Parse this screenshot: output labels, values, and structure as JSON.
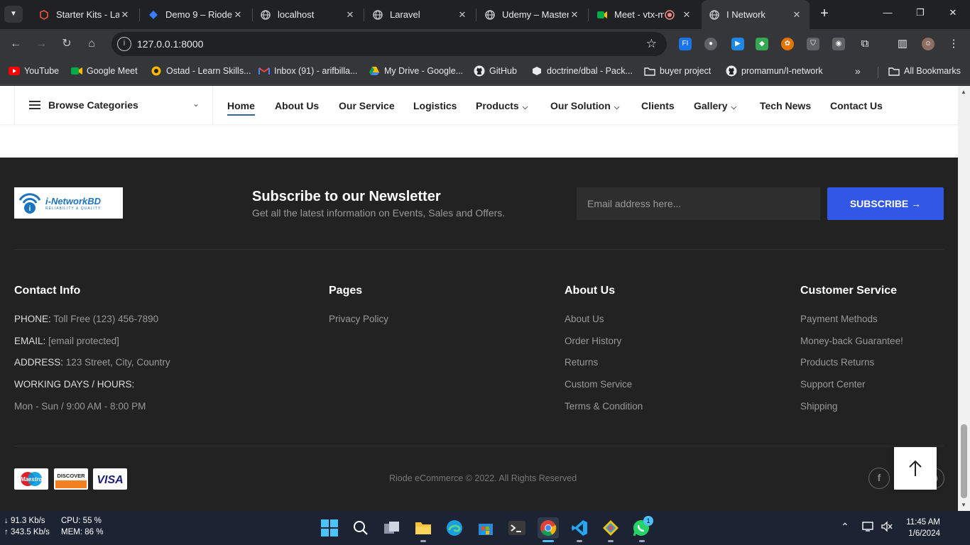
{
  "browser": {
    "tabs": [
      {
        "title": "Starter Kits - Lara",
        "icon": "laravel-icon",
        "color": "#f05340"
      },
      {
        "title": "Demo 9 – Riode",
        "icon": "riode-icon",
        "color": "#3a7cff"
      },
      {
        "title": "localhost",
        "icon": "globe-icon",
        "color": "#c4c7c5"
      },
      {
        "title": "Laravel",
        "icon": "globe-icon",
        "color": "#c4c7c5"
      },
      {
        "title": "Udemy – Master",
        "icon": "globe-icon",
        "color": "#c4c7c5"
      },
      {
        "title": "Meet - vtx-m",
        "icon": "meet-icon",
        "color": "#00ac47"
      },
      {
        "title": "I Network",
        "icon": "globe-icon",
        "color": "#c4c7c5",
        "active": true
      }
    ],
    "url": "127.0.0.1:8000",
    "bookmarks": [
      {
        "label": "YouTube",
        "icon": "youtube-icon"
      },
      {
        "label": "Google Meet",
        "icon": "meet-icon"
      },
      {
        "label": "Ostad - Learn Skills...",
        "icon": "ostad-icon"
      },
      {
        "label": "Inbox (91) - arifbilla...",
        "icon": "gmail-icon"
      },
      {
        "label": "My Drive - Google...",
        "icon": "drive-icon"
      },
      {
        "label": "GitHub",
        "icon": "github-icon"
      },
      {
        "label": "doctrine/dbal - Pack...",
        "icon": "packagist-icon"
      },
      {
        "label": "buyer project",
        "icon": "folder-icon"
      },
      {
        "label": "promamun/I-network",
        "icon": "github-icon"
      }
    ],
    "all_bookmarks": "All Bookmarks"
  },
  "navbar": {
    "browse_label": "Browse Categories",
    "menu": [
      {
        "label": "Home",
        "active": true
      },
      {
        "label": "About Us"
      },
      {
        "label": "Our Service"
      },
      {
        "label": "Logistics"
      },
      {
        "label": "Products",
        "dropdown": true
      },
      {
        "label": "Our Solution",
        "dropdown": true
      },
      {
        "label": "Clients"
      },
      {
        "label": "Gallery",
        "dropdown": true
      },
      {
        "label": "Tech News"
      },
      {
        "label": "Contact Us"
      }
    ]
  },
  "footer": {
    "logo_line1": "i-NetworkBD",
    "logo_line2": "RELIABILITY & QUALITY",
    "newsletter_title": "Subscribe to our Newsletter",
    "newsletter_sub": "Get all the latest information on Events, Sales and Offers.",
    "email_placeholder": "Email address here...",
    "subscribe_label": "SUBSCRIBE →",
    "contact": {
      "title": "Contact Info",
      "phone_label": "PHONE:",
      "phone": "Toll Free (123) 456-7890",
      "email_label": "EMAIL:",
      "email": "[email protected]",
      "address_label": "ADDRESS:",
      "address": "123 Street, City, Country",
      "hours_label": "WORKING DAYS / HOURS:",
      "hours": "Mon - Sun / 9:00 AM - 8:00 PM"
    },
    "pages": {
      "title": "Pages",
      "links": [
        "Privacy Policy"
      ]
    },
    "about": {
      "title": "About Us",
      "links": [
        "About Us",
        "Order History",
        "Returns",
        "Custom Service",
        "Terms & Condition"
      ]
    },
    "customer": {
      "title": "Customer Service",
      "links": [
        "Payment Methods",
        "Money-back Guarantee!",
        "Products Returns",
        "Support Center",
        "Shipping"
      ]
    },
    "payments": [
      "Maestro",
      "DISCOVER",
      "VISA"
    ],
    "copyright": "Riode eCommerce © 2022. All Rights Reserved"
  },
  "taskbar": {
    "net_down": "↓  91.3 Kb/s",
    "net_up": "↑  343.5 Kb/s",
    "cpu": "CPU: 55 %",
    "mem": "MEM: 86 %",
    "whatsapp_badge": "1",
    "time": "11:45 AM",
    "date": "1/6/2024"
  }
}
